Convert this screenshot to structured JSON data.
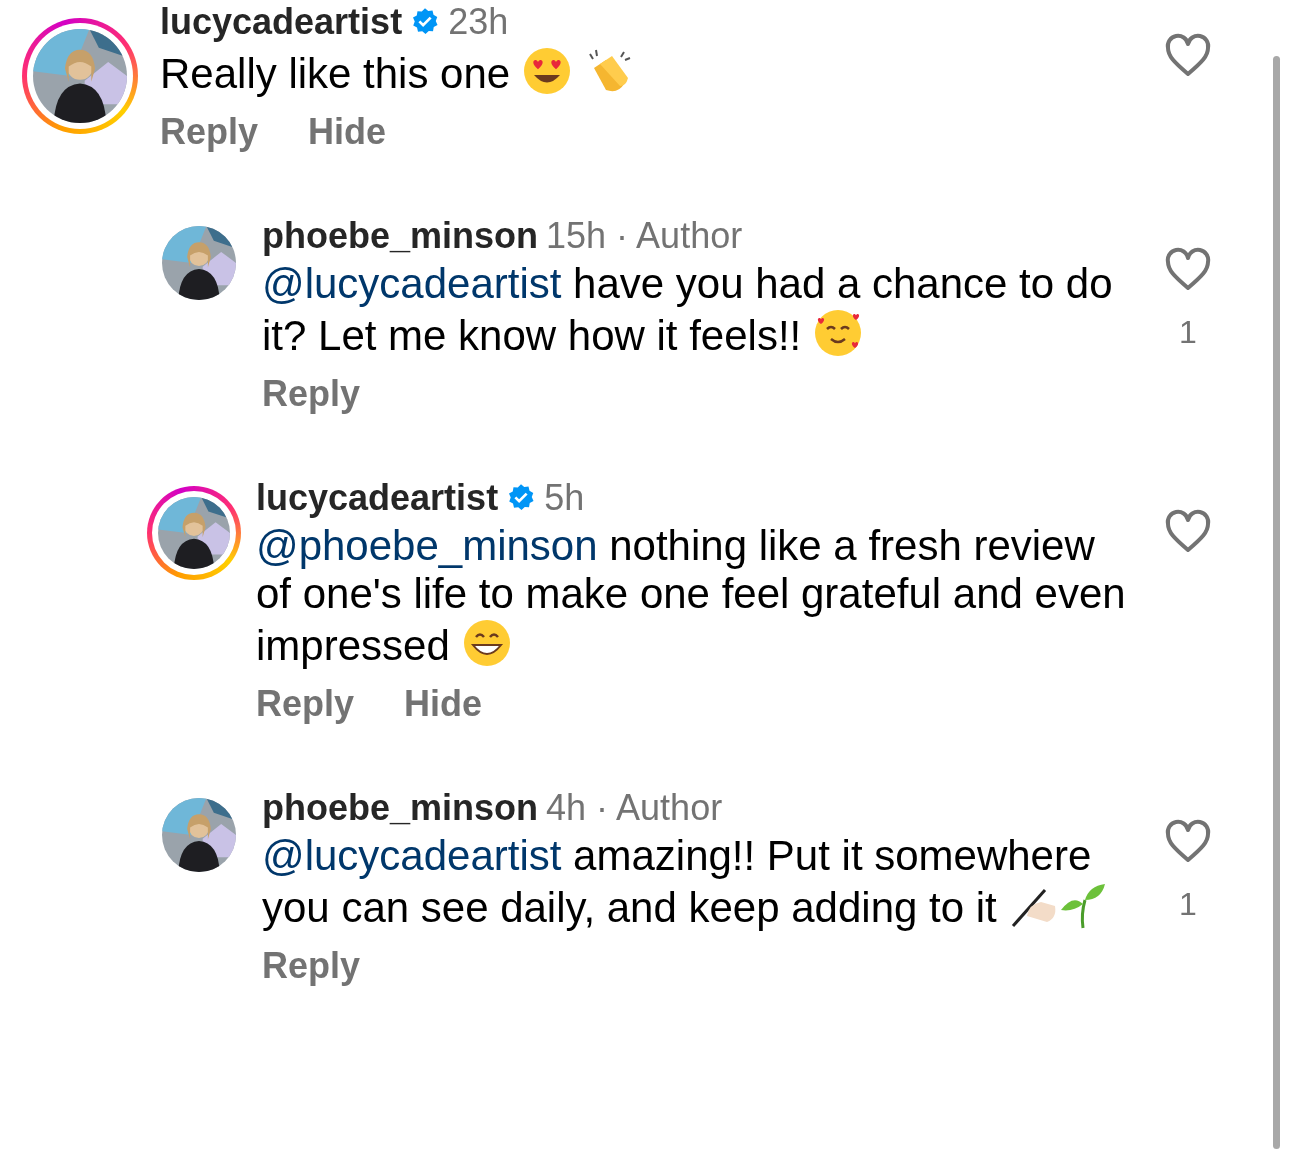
{
  "comment": {
    "author": "lucycadeartist",
    "story_ring": true,
    "verified": true,
    "meta": "23h",
    "text": "Really like this one",
    "emoji": [
      {
        "kind": "heart_eyes"
      },
      {
        "kind": "clap"
      }
    ],
    "actions": [
      "Reply",
      "Hide"
    ],
    "liked": false,
    "replies": [
      {
        "author": "phoebe_minson",
        "story_ring": false,
        "verified": false,
        "meta": "15h · Author",
        "mention": "@lucycadeartist",
        "text": "have you had a chance to do it? Let me know how it feels!!",
        "emoji": [
          {
            "kind": "smiling_hearts"
          }
        ],
        "actions": [
          "Reply"
        ],
        "liked": false,
        "likes": "1"
      },
      {
        "author": "lucycadeartist",
        "story_ring": true,
        "verified": true,
        "meta": "5h",
        "mention": "@phoebe_minson",
        "text": "nothing like a fresh review of one's life to make one feel grateful and even impressed",
        "emoji": [
          {
            "kind": "grin"
          }
        ],
        "actions": [
          "Reply",
          "Hide"
        ],
        "liked": false
      },
      {
        "author": "phoebe_minson",
        "story_ring": false,
        "verified": false,
        "meta": "4h · Author",
        "mention": "@lucycadeartist",
        "text": "amazing!! Put it somewhere you can see daily, and keep adding to it",
        "emoji": [
          {
            "kind": "writing_hand"
          },
          {
            "kind": "seedling"
          }
        ],
        "actions": [
          "Reply"
        ],
        "liked": false,
        "likes": "1"
      }
    ]
  }
}
